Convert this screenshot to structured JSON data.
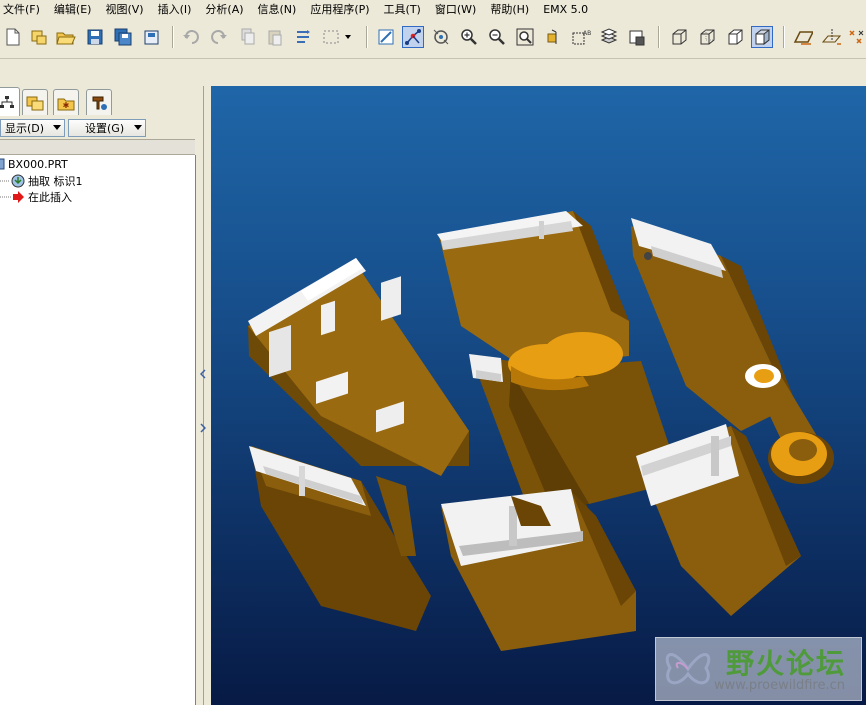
{
  "menu": [
    "文件(F)",
    "编辑(E)",
    "视图(V)",
    "插入(I)",
    "分析(A)",
    "信息(N)",
    "应用程序(P)",
    "工具(T)",
    "窗口(W)",
    "帮助(H)",
    "EMX 5.0"
  ],
  "toolbar": {
    "icons": [
      "new-icon",
      "open-session-icon",
      "open-folder-icon",
      "save-icon",
      "save-copy-icon",
      "backup-icon",
      "undo-icon",
      "redo-icon",
      "copy-icon",
      "paste-icon",
      "paste-special-icon",
      "select-box-icon",
      "repaint-icon",
      "spin-center-icon",
      "orient-icon",
      "zoom-in-icon",
      "zoom-out-icon",
      "refit-icon",
      "view-manager-icon",
      "saved-views-icon",
      "layers-icon",
      "model-display-icon",
      "wireframe-icon",
      "hidden-line-icon",
      "no-hidden-icon",
      "shading-icon",
      "datum-planes-icon",
      "datum-axes-icon",
      "datum-points-icon"
    ]
  },
  "panel": {
    "dropdown_show": "显示(D)",
    "dropdown_settings": "设置(G)",
    "tree": {
      "root": "BX000.PRT",
      "items": [
        "抽取 标识1",
        "在此插入"
      ]
    }
  },
  "watermark": {
    "title": "野火论坛",
    "url": "www.proewildfire.cn"
  },
  "colors": {
    "part_body": "#9a6a10",
    "part_face": "#e89e12",
    "part_highlight": "#f0f0f0",
    "viewport_top": "#1f66a8",
    "viewport_bottom": "#071a45"
  }
}
